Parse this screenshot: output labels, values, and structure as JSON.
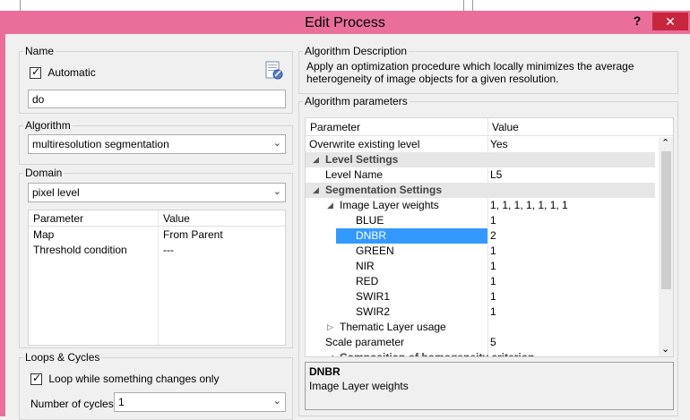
{
  "window": {
    "title": "Edit Process",
    "help_label": "?",
    "close_label": "✕"
  },
  "name_group": {
    "label": "Name",
    "automatic_label": "Automatic",
    "automatic_checked": true,
    "name_value": "do",
    "icon": "edit-name-icon"
  },
  "algorithm_group": {
    "label": "Algorithm",
    "value": "multiresolution segmentation"
  },
  "domain_group": {
    "label": "Domain",
    "value": "pixel level",
    "headers": {
      "parameter": "Parameter",
      "value": "Value"
    },
    "rows": [
      {
        "parameter": "Map",
        "value": "From Parent"
      },
      {
        "parameter": "Threshold condition",
        "value": "---"
      }
    ]
  },
  "loops_group": {
    "label": "Loops & Cycles",
    "loop_label": "Loop while something changes only",
    "loop_checked": true,
    "cycles_label": "Number of cycles",
    "cycles_value": "1"
  },
  "description_group": {
    "label": "Algorithm Description",
    "text": "Apply an optimization procedure which locally minimizes the average heterogeneity of image objects for a given resolution."
  },
  "params_group": {
    "label": "Algorithm parameters",
    "headers": {
      "parameter": "Parameter",
      "value": "Value"
    },
    "rows": [
      {
        "label": "Overwrite existing level",
        "value": "Yes"
      },
      {
        "label": "Level Settings",
        "value": ""
      },
      {
        "label": "Level Name",
        "value": "L5"
      },
      {
        "label": "Segmentation Settings",
        "value": ""
      },
      {
        "label": "Image Layer weights",
        "value": "1, 1, 1, 1, 1, 1, 1"
      },
      {
        "label": "BLUE",
        "value": "1"
      },
      {
        "label": "DNBR",
        "value": "2"
      },
      {
        "label": "GREEN",
        "value": "1"
      },
      {
        "label": "NIR",
        "value": "1"
      },
      {
        "label": "RED",
        "value": "1"
      },
      {
        "label": "SWIR1",
        "value": "1"
      },
      {
        "label": "SWIR2",
        "value": "1"
      },
      {
        "label": "Thematic Layer usage",
        "value": ""
      },
      {
        "label": "Scale parameter",
        "value": "5"
      },
      {
        "label": "Composition of homogeneity criterion",
        "value": ""
      }
    ],
    "selected_index": 6,
    "detail_title": "DNBR",
    "detail_text": "Image Layer weights"
  },
  "colors": {
    "frame": "#e96f9a",
    "selection": "#3399ff",
    "close": "#c7263e"
  }
}
